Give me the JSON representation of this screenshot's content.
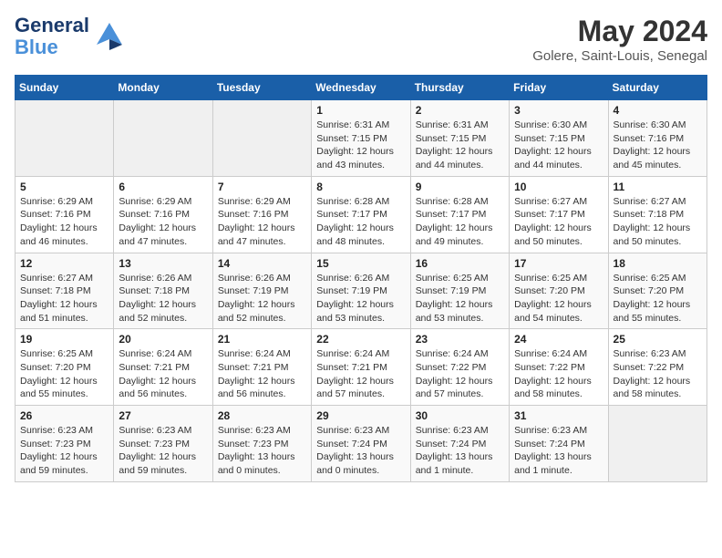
{
  "header": {
    "logo_line1": "General",
    "logo_line2": "Blue",
    "month_year": "May 2024",
    "location": "Golere, Saint-Louis, Senegal"
  },
  "days_of_week": [
    "Sunday",
    "Monday",
    "Tuesday",
    "Wednesday",
    "Thursday",
    "Friday",
    "Saturday"
  ],
  "weeks": [
    [
      {
        "num": "",
        "info": ""
      },
      {
        "num": "",
        "info": ""
      },
      {
        "num": "",
        "info": ""
      },
      {
        "num": "1",
        "info": "Sunrise: 6:31 AM\nSunset: 7:15 PM\nDaylight: 12 hours\nand 43 minutes."
      },
      {
        "num": "2",
        "info": "Sunrise: 6:31 AM\nSunset: 7:15 PM\nDaylight: 12 hours\nand 44 minutes."
      },
      {
        "num": "3",
        "info": "Sunrise: 6:30 AM\nSunset: 7:15 PM\nDaylight: 12 hours\nand 44 minutes."
      },
      {
        "num": "4",
        "info": "Sunrise: 6:30 AM\nSunset: 7:16 PM\nDaylight: 12 hours\nand 45 minutes."
      }
    ],
    [
      {
        "num": "5",
        "info": "Sunrise: 6:29 AM\nSunset: 7:16 PM\nDaylight: 12 hours\nand 46 minutes."
      },
      {
        "num": "6",
        "info": "Sunrise: 6:29 AM\nSunset: 7:16 PM\nDaylight: 12 hours\nand 47 minutes."
      },
      {
        "num": "7",
        "info": "Sunrise: 6:29 AM\nSunset: 7:16 PM\nDaylight: 12 hours\nand 47 minutes."
      },
      {
        "num": "8",
        "info": "Sunrise: 6:28 AM\nSunset: 7:17 PM\nDaylight: 12 hours\nand 48 minutes."
      },
      {
        "num": "9",
        "info": "Sunrise: 6:28 AM\nSunset: 7:17 PM\nDaylight: 12 hours\nand 49 minutes."
      },
      {
        "num": "10",
        "info": "Sunrise: 6:27 AM\nSunset: 7:17 PM\nDaylight: 12 hours\nand 50 minutes."
      },
      {
        "num": "11",
        "info": "Sunrise: 6:27 AM\nSunset: 7:18 PM\nDaylight: 12 hours\nand 50 minutes."
      }
    ],
    [
      {
        "num": "12",
        "info": "Sunrise: 6:27 AM\nSunset: 7:18 PM\nDaylight: 12 hours\nand 51 minutes."
      },
      {
        "num": "13",
        "info": "Sunrise: 6:26 AM\nSunset: 7:18 PM\nDaylight: 12 hours\nand 52 minutes."
      },
      {
        "num": "14",
        "info": "Sunrise: 6:26 AM\nSunset: 7:19 PM\nDaylight: 12 hours\nand 52 minutes."
      },
      {
        "num": "15",
        "info": "Sunrise: 6:26 AM\nSunset: 7:19 PM\nDaylight: 12 hours\nand 53 minutes."
      },
      {
        "num": "16",
        "info": "Sunrise: 6:25 AM\nSunset: 7:19 PM\nDaylight: 12 hours\nand 53 minutes."
      },
      {
        "num": "17",
        "info": "Sunrise: 6:25 AM\nSunset: 7:20 PM\nDaylight: 12 hours\nand 54 minutes."
      },
      {
        "num": "18",
        "info": "Sunrise: 6:25 AM\nSunset: 7:20 PM\nDaylight: 12 hours\nand 55 minutes."
      }
    ],
    [
      {
        "num": "19",
        "info": "Sunrise: 6:25 AM\nSunset: 7:20 PM\nDaylight: 12 hours\nand 55 minutes."
      },
      {
        "num": "20",
        "info": "Sunrise: 6:24 AM\nSunset: 7:21 PM\nDaylight: 12 hours\nand 56 minutes."
      },
      {
        "num": "21",
        "info": "Sunrise: 6:24 AM\nSunset: 7:21 PM\nDaylight: 12 hours\nand 56 minutes."
      },
      {
        "num": "22",
        "info": "Sunrise: 6:24 AM\nSunset: 7:21 PM\nDaylight: 12 hours\nand 57 minutes."
      },
      {
        "num": "23",
        "info": "Sunrise: 6:24 AM\nSunset: 7:22 PM\nDaylight: 12 hours\nand 57 minutes."
      },
      {
        "num": "24",
        "info": "Sunrise: 6:24 AM\nSunset: 7:22 PM\nDaylight: 12 hours\nand 58 minutes."
      },
      {
        "num": "25",
        "info": "Sunrise: 6:23 AM\nSunset: 7:22 PM\nDaylight: 12 hours\nand 58 minutes."
      }
    ],
    [
      {
        "num": "26",
        "info": "Sunrise: 6:23 AM\nSunset: 7:23 PM\nDaylight: 12 hours\nand 59 minutes."
      },
      {
        "num": "27",
        "info": "Sunrise: 6:23 AM\nSunset: 7:23 PM\nDaylight: 12 hours\nand 59 minutes."
      },
      {
        "num": "28",
        "info": "Sunrise: 6:23 AM\nSunset: 7:23 PM\nDaylight: 13 hours\nand 0 minutes."
      },
      {
        "num": "29",
        "info": "Sunrise: 6:23 AM\nSunset: 7:24 PM\nDaylight: 13 hours\nand 0 minutes."
      },
      {
        "num": "30",
        "info": "Sunrise: 6:23 AM\nSunset: 7:24 PM\nDaylight: 13 hours\nand 1 minute."
      },
      {
        "num": "31",
        "info": "Sunrise: 6:23 AM\nSunset: 7:24 PM\nDaylight: 13 hours\nand 1 minute."
      },
      {
        "num": "",
        "info": ""
      }
    ]
  ]
}
